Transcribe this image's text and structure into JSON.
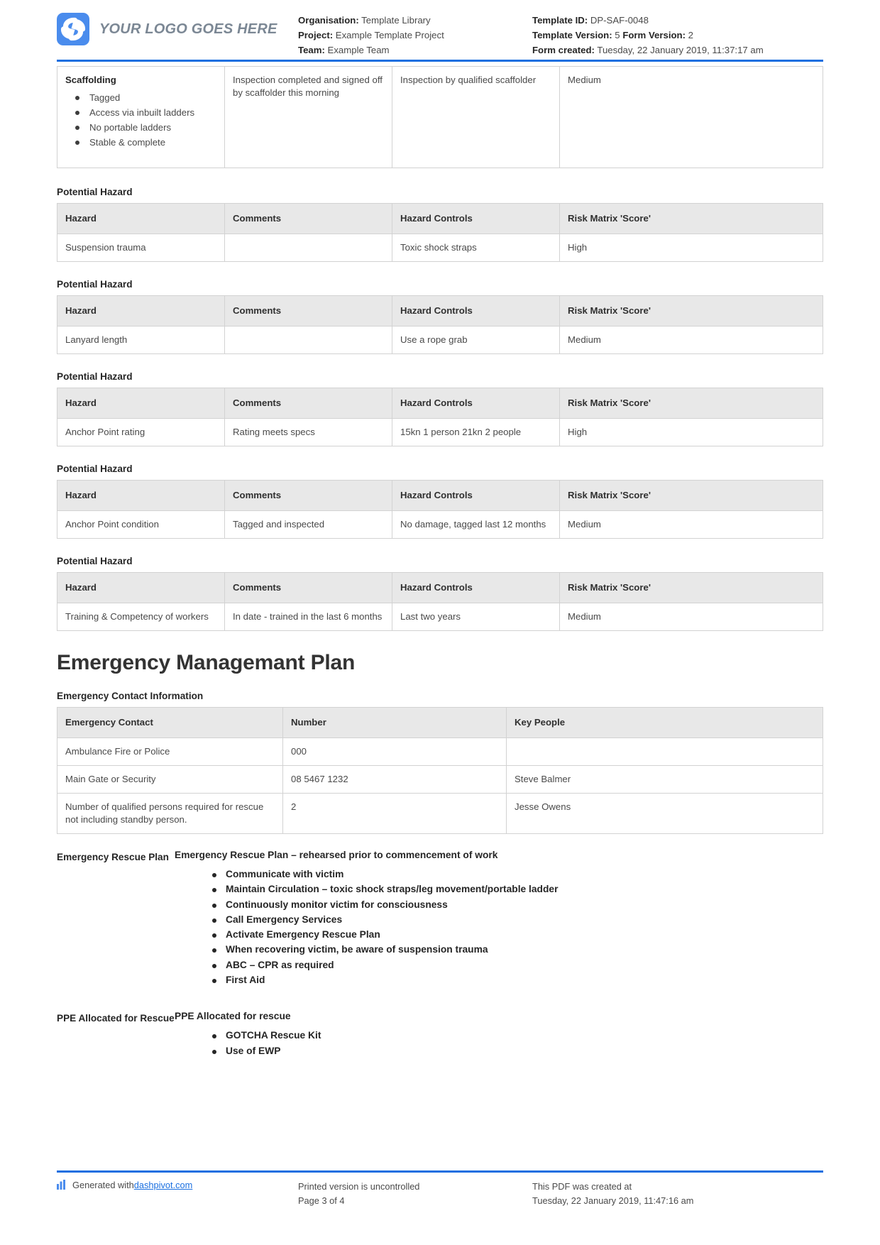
{
  "header": {
    "logo_text": "YOUR LOGO GOES HERE",
    "logo_icon": "dashpivot-logo-icon",
    "fields": [
      {
        "label": "Organisation:",
        "value": "Template Library"
      },
      {
        "label": "Project:",
        "value": "Example Template Project"
      },
      {
        "label": "Team:",
        "value": "Example Team"
      }
    ],
    "right_fields": {
      "template_id_label": "Template ID:",
      "template_id_value": "DP-SAF-0048",
      "template_version_label": "Template Version:",
      "template_version_value": "5",
      "form_version_label": "Form Version:",
      "form_version_value": "2",
      "form_created_label": "Form created:",
      "form_created_value": "Tuesday, 22 January 2019, 11:37:17 am"
    }
  },
  "scaffolding": {
    "title": "Scaffolding",
    "bullets": [
      "Tagged",
      "Access via inbuilt ladders",
      "No portable ladders",
      "Stable & complete"
    ],
    "comments": "Inspection completed and signed off by scaffolder this morning",
    "controls": "Inspection by qualified scaffolder",
    "score": "Medium"
  },
  "hazard_section_label": "Potential Hazard",
  "hazard_columns": [
    "Hazard",
    "Comments",
    "Hazard Controls",
    "Risk Matrix 'Score'"
  ],
  "hazards": [
    {
      "hazard": "Suspension trauma",
      "comments": "",
      "controls": "Toxic shock straps",
      "score": "High"
    },
    {
      "hazard": "Lanyard length",
      "comments": "",
      "controls": "Use a rope grab",
      "score": "Medium"
    },
    {
      "hazard": "Anchor Point rating",
      "comments": "Rating meets specs",
      "controls": "15kn 1 person 21kn 2 people",
      "score": "High"
    },
    {
      "hazard": "Anchor Point condition",
      "comments": "Tagged and inspected",
      "controls": "No damage, tagged last 12 months",
      "score": "Medium"
    },
    {
      "hazard": "Training & Competency of workers",
      "comments": "In date - trained in the last 6 months",
      "controls": "Last two years",
      "score": "Medium"
    }
  ],
  "emergency": {
    "plan_title": "Emergency Managemant Plan",
    "contact_section_label": "Emergency Contact Information",
    "contact_columns": [
      "Emergency Contact",
      "Number",
      "Key People"
    ],
    "contacts": [
      {
        "contact": "Ambulance Fire or Police",
        "number": "000",
        "people": ""
      },
      {
        "contact": "Main Gate or Security",
        "number": "08 5467 1232",
        "people": "Steve Balmer"
      },
      {
        "contact": "Number of qualified persons required for rescue not including standby person.",
        "number": "2",
        "people": "Jesse Owens"
      }
    ],
    "rescue_plan": {
      "side_label": "Emergency Rescue Plan",
      "heading": "Emergency Rescue Plan – rehearsed prior to commencement of work",
      "items": [
        "Communicate with victim",
        "Maintain Circulation – toxic shock straps/leg movement/portable ladder",
        "Continuously monitor victim for consciousness",
        "Call Emergency Services",
        "Activate Emergency Rescue Plan",
        "When recovering victim, be aware of suspension trauma",
        "ABC – CPR as required",
        "First Aid"
      ]
    },
    "ppe": {
      "side_label": "PPE Allocated for Rescue",
      "heading": "PPE Allocated for rescue",
      "items": [
        "GOTCHA Rescue Kit",
        "Use of EWP"
      ]
    }
  },
  "footer": {
    "generated_prefix": "Generated with ",
    "generated_link": "dashpivot.com",
    "uncontrolled": "Printed version is uncontrolled",
    "page_number": "Page 3 of 4",
    "created_at_label": "This PDF was created at",
    "created_at_value": "Tuesday, 22 January 2019, 11:47:16 am"
  },
  "colors": {
    "accent_blue": "#1a6fe0",
    "logo_blue": "#4a8ced",
    "header_gray": "#e8e8e8"
  }
}
